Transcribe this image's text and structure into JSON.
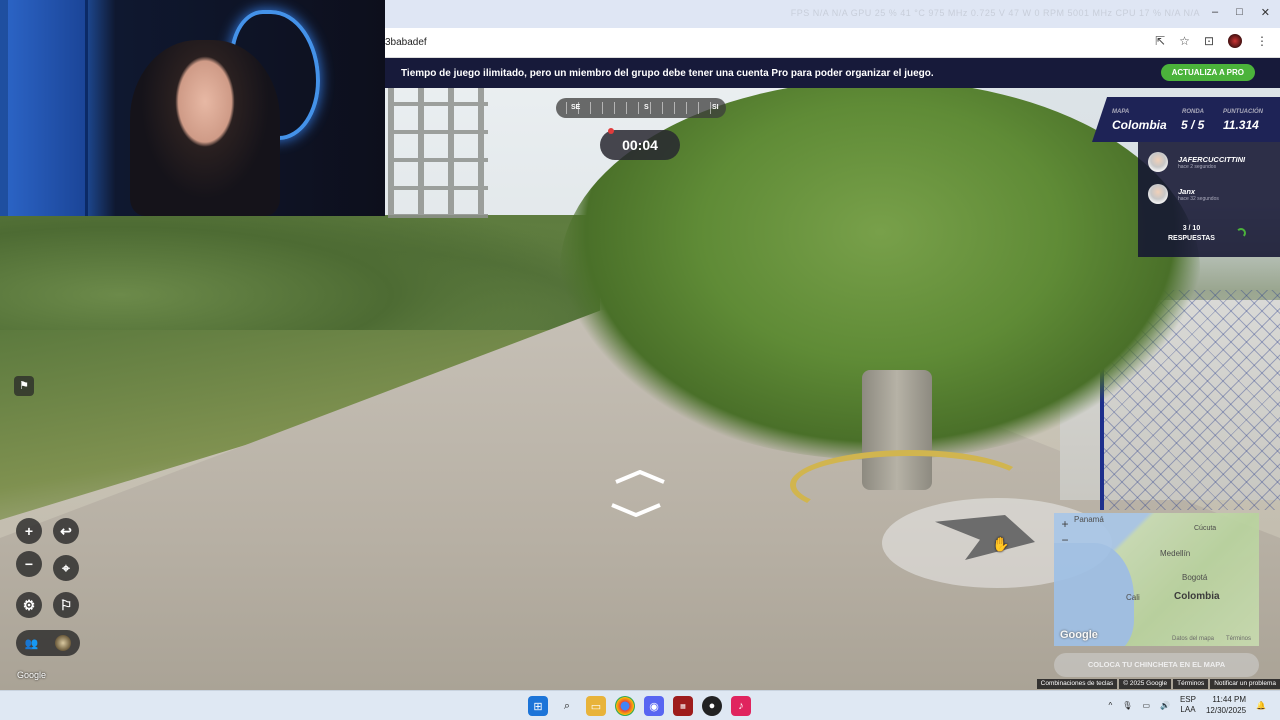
{
  "browser": {
    "address_fragment": "3babadef",
    "system_stats": "FPS N/A N/A   GPU 25 % 41 °C 975 MHz 0.725 V 47 W 0 RPM 5001 MHz   CPU 17 % N/A N/A",
    "window_controls": [
      "–",
      "□",
      "✕"
    ],
    "icons": [
      "cast-icon",
      "bookmark-star-icon",
      "tab-search-icon",
      "profile-avatar",
      "menu-dots-icon"
    ]
  },
  "promo": {
    "message": "Tiempo de juego ilimitado, pero un miembro del grupo debe tener una cuenta Pro para poder organizar el juego.",
    "button_label": "ACTUALIZA A PRO",
    "button_color": "#4bb33b"
  },
  "compass": {
    "labels": [
      "SE",
      "S",
      "SI"
    ]
  },
  "timer": {
    "value": "00:04"
  },
  "scoreboard": {
    "map_label": "MAPA",
    "map_value": "Colombia",
    "round_label": "RONDA",
    "round_value": "5 / 5",
    "score_label": "PUNTUACIÓN",
    "score_value": "11.314",
    "players": [
      {
        "name": "JAFERCUCCITTINI",
        "time": "hace 2 segundos"
      },
      {
        "name": "Janx",
        "time": "hace 32 segundos"
      }
    ],
    "responses_count": "3 / 10",
    "responses_label": "RESPUESTAS"
  },
  "controls": {
    "zoom_in": "+",
    "zoom_out": "−",
    "undo_icon": "undo-arrow-icon",
    "checkpoint_icon": "location-pin-icon",
    "settings_icon": "gear-icon",
    "flag_icon": "flag-icon",
    "report_icon": "report-icon"
  },
  "street_view": {
    "watermark": "Google"
  },
  "minimap": {
    "labels": {
      "panama": "Panamá",
      "cucuta": "Cúcuta",
      "medellin": "Medellín",
      "bogota": "Bogotá",
      "cali": "Cali",
      "colombia": "Colombia"
    },
    "zoom_in": "+",
    "zoom_out": "−",
    "google": "Google",
    "map_data": "Datos del mapa",
    "terms": "Términos",
    "pin_button": "COLOCA TU CHINCHETA EN EL MAPA"
  },
  "footer": {
    "items": [
      "Combinaciones de teclas",
      "© 2025 Google",
      "Términos",
      "Notificar un problema"
    ]
  },
  "taskbar": {
    "apps": [
      "windows-start-icon",
      "search-icon",
      "file-explorer-icon",
      "chrome-icon",
      "discord-icon",
      "voicemeeter-icon",
      "obs-icon",
      "tiktok-icon"
    ],
    "language_line1": "ESP",
    "language_line2": "LAA",
    "time": "11:44 PM",
    "date": "12/30/2025"
  }
}
